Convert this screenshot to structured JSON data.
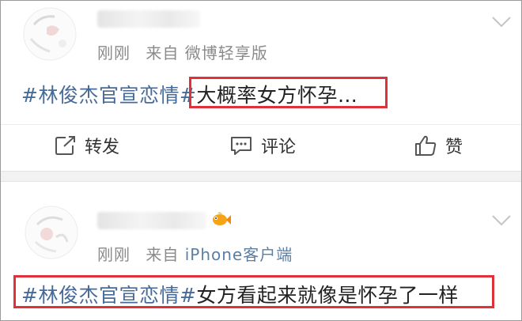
{
  "post1": {
    "time": "刚刚",
    "source_prefix": "来自",
    "source": "微博轻享版",
    "hashtag": "#林俊杰官宣恋情#",
    "text": "大概率女方怀孕…",
    "actions": {
      "repost_label": "转发",
      "comment_label": "评论",
      "like_label": "赞"
    }
  },
  "post2": {
    "time": "刚刚",
    "source_prefix": "来自",
    "source": "iPhone客户端",
    "hashtag": "#林俊杰官宣恋情#",
    "text": "女方看起来就像是怀孕了一样"
  },
  "icons": {
    "more": "chevron-down-icon",
    "repost": "repost-icon",
    "comment": "comment-icon",
    "like": "thumbs-up-icon",
    "vip": "goldfish-badge-icon"
  },
  "colors": {
    "hashtag": "#466a99",
    "highlight_box": "#e0313b",
    "meta_text": "#8a8a8a",
    "iphone_source": "#5b7ea3"
  }
}
